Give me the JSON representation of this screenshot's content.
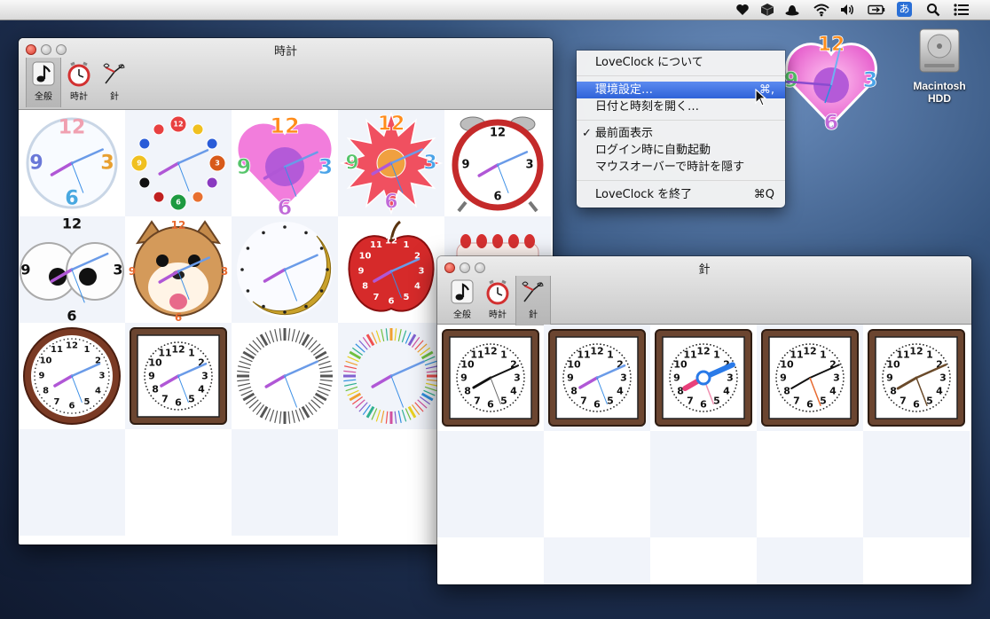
{
  "menubar": {
    "icons": [
      "heart-icon",
      "cube-icon",
      "hat-icon",
      "wifi-icon",
      "volume-icon",
      "battery-icon",
      "input-method-icon",
      "spotlight-icon",
      "list-icon"
    ],
    "ime_label": "あ"
  },
  "desktop": {
    "hdd_label": "Macintosh\nHDD"
  },
  "clock_window": {
    "title": "時計",
    "toolbar": [
      {
        "label": "全般",
        "icon": "music-note-icon",
        "selected": true
      },
      {
        "label": "時計",
        "icon": "alarm-clock-icon",
        "selected": false
      },
      {
        "label": "針",
        "icon": "clock-hands-icon",
        "selected": false
      }
    ],
    "clocks": [
      {
        "style": "rainbow-numerals",
        "numerals": [
          "12",
          "3",
          "6",
          "9"
        ]
      },
      {
        "style": "billiard-balls",
        "numerals": [
          "12",
          "3",
          "6",
          "9"
        ]
      },
      {
        "style": "pink-heart",
        "numerals": [
          "12",
          "3",
          "6",
          "9"
        ]
      },
      {
        "style": "red-burst",
        "numerals": [
          "12",
          "3",
          "6",
          "9"
        ]
      },
      {
        "style": "red-alarm-clock",
        "numerals": [
          "12",
          "3",
          "6",
          "9"
        ]
      },
      {
        "style": "googly-eyes",
        "numerals": [
          "12",
          "3",
          "6",
          "9"
        ]
      },
      {
        "style": "shiba-dog",
        "numerals": [
          "12",
          "3",
          "6",
          "9"
        ]
      },
      {
        "style": "crescent-moon",
        "numerals": []
      },
      {
        "style": "red-apple",
        "numerals": [
          "12",
          "1",
          "2",
          "3",
          "4",
          "5",
          "6",
          "7",
          "8",
          "9",
          "10",
          "11"
        ]
      },
      {
        "style": "cake",
        "numerals": []
      },
      {
        "style": "wooden-round",
        "numerals": [
          "12",
          "1",
          "2",
          "3",
          "4",
          "5",
          "6",
          "7",
          "8",
          "9",
          "10",
          "11"
        ]
      },
      {
        "style": "square-frame",
        "numerals": [
          "12",
          "1",
          "2",
          "3",
          "4",
          "5",
          "6",
          "7",
          "8",
          "9",
          "10",
          "11"
        ]
      },
      {
        "style": "gray-ticks",
        "numerals": []
      },
      {
        "style": "rainbow-ticks",
        "numerals": []
      },
      {
        "style": "rainbow-rays",
        "numerals": []
      }
    ]
  },
  "hands_window": {
    "title": "針",
    "toolbar": [
      {
        "label": "全般",
        "icon": "music-note-icon",
        "selected": false
      },
      {
        "label": "時計",
        "icon": "alarm-clock-icon",
        "selected": false
      },
      {
        "label": "針",
        "icon": "clock-hands-icon",
        "selected": true
      }
    ],
    "hands": [
      {
        "style": "black-hands",
        "numerals": [
          "12",
          "1",
          "2",
          "3",
          "4",
          "5",
          "6",
          "7",
          "8",
          "9",
          "10",
          "11"
        ]
      },
      {
        "style": "purple-blue-hands",
        "numerals": [
          "12",
          "1",
          "2",
          "3",
          "4",
          "5",
          "6",
          "7",
          "8",
          "9",
          "10",
          "11"
        ]
      },
      {
        "style": "pink-blue-bold-hands",
        "numerals": [
          "12",
          "1",
          "2",
          "3",
          "4",
          "5",
          "6",
          "7",
          "8",
          "9",
          "10",
          "11"
        ]
      },
      {
        "style": "skeleton-hands",
        "numerals": [
          "12",
          "1",
          "2",
          "3",
          "4",
          "5",
          "6",
          "7",
          "8",
          "9",
          "10",
          "11"
        ]
      },
      {
        "style": "branch-hands",
        "numerals": [
          "12",
          "1",
          "2",
          "3",
          "4",
          "5",
          "6",
          "7",
          "8",
          "9",
          "10",
          "11"
        ]
      }
    ]
  },
  "context_menu": {
    "items": [
      {
        "label": "LoveClock について",
        "shortcut": "",
        "checked": false,
        "highlighted": false
      },
      {
        "separator": true
      },
      {
        "label": "環境設定…",
        "shortcut": "⌘,",
        "checked": false,
        "highlighted": true
      },
      {
        "label": "日付と時刻を開く…",
        "shortcut": "",
        "checked": false,
        "highlighted": false
      },
      {
        "separator": true
      },
      {
        "label": "最前面表示",
        "shortcut": "",
        "checked": true,
        "highlighted": false
      },
      {
        "label": "ログイン時に自動起動",
        "shortcut": "",
        "checked": false,
        "highlighted": false
      },
      {
        "label": "マウスオーバーで時計を隠す",
        "shortcut": "",
        "checked": false,
        "highlighted": false
      },
      {
        "separator": true
      },
      {
        "label": "LoveClock を終了",
        "shortcut": "⌘Q",
        "checked": false,
        "highlighted": false
      }
    ]
  },
  "colors": {
    "menu_highlight": "#3366dd",
    "hour_hand": "#b057d6",
    "minute_hand": "#6a9be8",
    "wood": "#6b4530"
  }
}
